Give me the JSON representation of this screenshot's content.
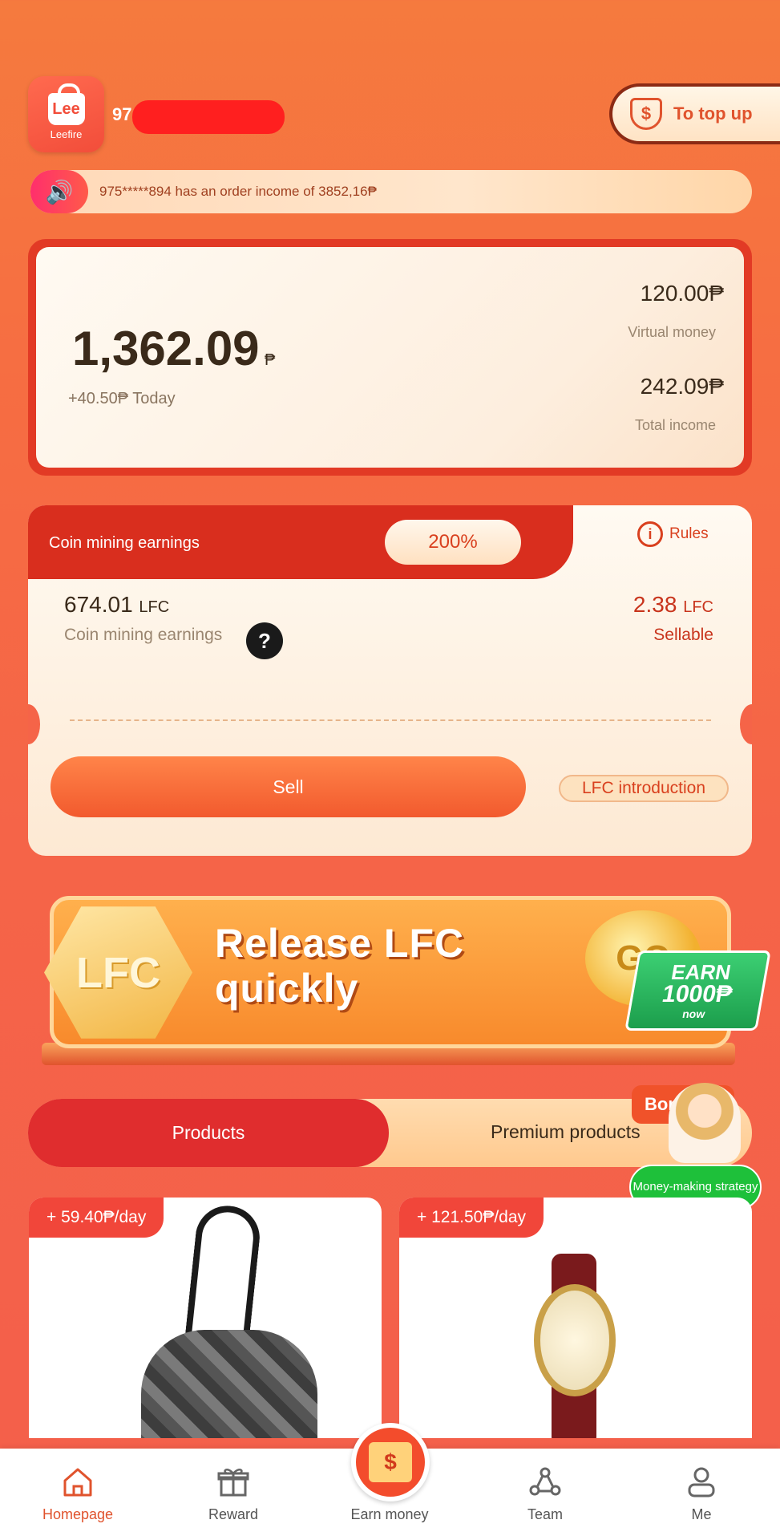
{
  "header": {
    "logo_text": "Lee",
    "logo_sub": "Leefire",
    "username_visible": "97",
    "topup_label": "To top up"
  },
  "marquee": {
    "text": "975*****894 has an order income of 3852,16₱"
  },
  "balance": {
    "amount": "1,362.09",
    "currency": "₱",
    "today": "+40.50₱ Today",
    "virtual_value": "120.00₱",
    "virtual_label": "Virtual money",
    "total_value": "242.09₱",
    "total_label": "Total income"
  },
  "mining": {
    "title": "Coin mining earnings",
    "percent": "200%",
    "rules_label": "Rules",
    "earnings_value": "674.01",
    "earnings_unit": "LFC",
    "earnings_label": "Coin mining earnings",
    "sellable_value": "2.38",
    "sellable_unit": "LFC",
    "sellable_label": "Sellable",
    "sell_button": "Sell",
    "intro_label": "LFC introduction"
  },
  "banner": {
    "hex_text": "LFC",
    "title_line1": "Release LFC",
    "title_line2": "quickly",
    "coin_text": "GO",
    "earn_line1": "EARN",
    "earn_line2": "1000₱",
    "earn_line3": "now"
  },
  "tabs": {
    "active": "Products",
    "other": "Premium products",
    "float_badge": "Bone",
    "float_button": "Money-making strategy"
  },
  "products": [
    {
      "badge": "+ 59.40₱/day",
      "item": "handbag"
    },
    {
      "badge": "+ 121.50₱/day",
      "item": "wristwatch"
    }
  ],
  "nav": {
    "items": [
      "Homepage",
      "Reward",
      "Earn money",
      "Team",
      "Me"
    ],
    "active": "Homepage",
    "accent": "#e0532d"
  }
}
